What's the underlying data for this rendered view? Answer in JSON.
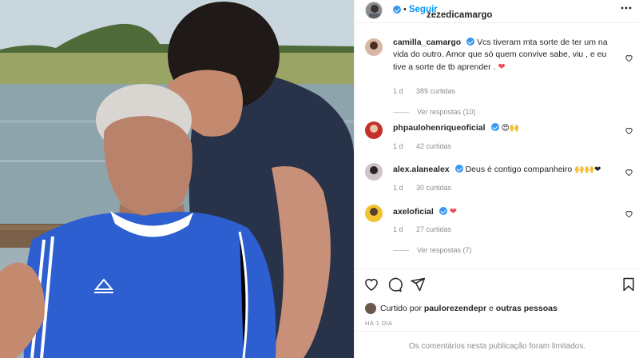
{
  "post": {
    "username": "zezedicamargo",
    "follow_label": "Seguir",
    "more_icon": "more-horizontal-icon",
    "separator": "•"
  },
  "comments": [
    {
      "username": "camilla_camargo",
      "text": "Vcs tiveram mta sorte de ter um na vida do outro. Amor que só quem convive sabe, viu , e eu tive a sorte de tb aprender .",
      "emoji": "❤",
      "age": "1 d",
      "likes": "389 curtidas",
      "replies_label": "Ver respostas (10)"
    },
    {
      "username": "phpaulohenriqueoficial",
      "text": "",
      "emoji": "😍🙌",
      "age": "1 d",
      "likes": "42 curtidas",
      "replies_label": ""
    },
    {
      "username": "alex.alanealex",
      "text": "Deus é contigo companheiro",
      "emoji": "🙌🙌❤",
      "age": "1 d",
      "likes": "30 curtidas",
      "replies_label": ""
    },
    {
      "username": "axeloficial",
      "text": "",
      "emoji": "❤",
      "age": "1 d",
      "likes": "27 curtidas",
      "replies_label": "Ver respostas (7)"
    }
  ],
  "liked_by": {
    "prefix": "Curtido por",
    "user": "paulorezendepr",
    "joiner": "e",
    "others": "outras pessoas"
  },
  "time_ago": "HÁ 1 DIA",
  "comments_limited": "Os comentários nesta publicação foram limitados.",
  "colors": {
    "link_blue": "#0095f6",
    "verified_blue": "#3897f0",
    "heart_red": "#ed4956",
    "muted_gray": "#8e8e8e"
  }
}
